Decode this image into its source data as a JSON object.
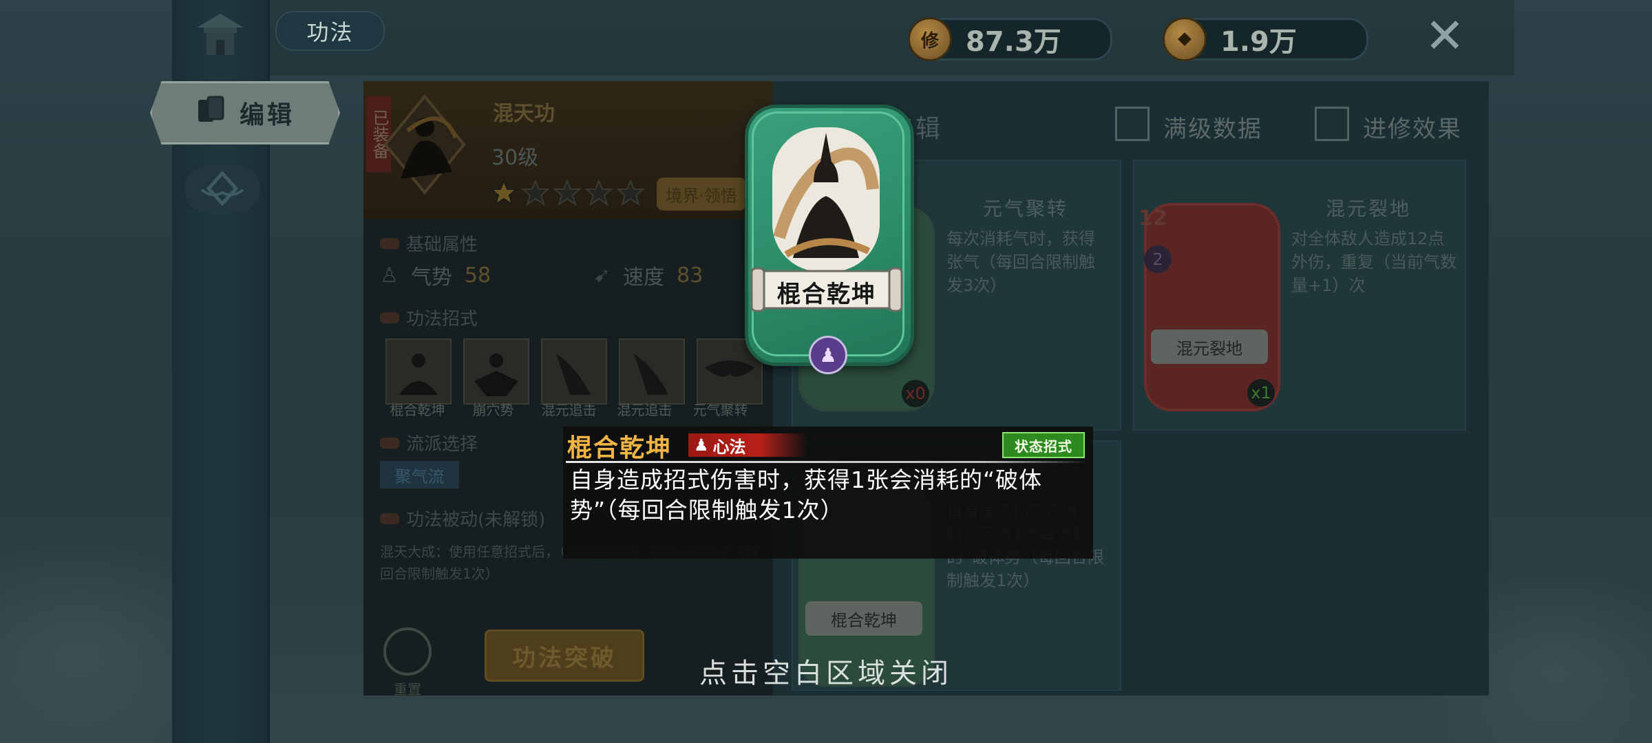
{
  "header": {
    "module_tab": "功法",
    "side_edit_tab": "编辑"
  },
  "currencies": [
    {
      "icon": "cultivation-coin-icon",
      "glyph": "修",
      "amount": "87.3万"
    },
    {
      "icon": "copper-coin-icon",
      "glyph": "",
      "amount": "1.9万"
    }
  ],
  "art": {
    "equipped_badge": "已装备",
    "name": "混天功",
    "level": "30级",
    "stars_filled": 1,
    "stars_total": 5,
    "realm_button": "境界·领悟",
    "sections": {
      "base": "基础属性",
      "moves": "功法招式",
      "school": "流派选择",
      "passive": "功法被动(未解锁)"
    },
    "stats": [
      {
        "label": "气势",
        "value": "58"
      },
      {
        "label": "速度",
        "value": "83"
      }
    ],
    "moves": [
      "棍合乾坤",
      "崩穴势",
      "混元追击",
      "混元追击",
      "元气聚转"
    ],
    "school_tag": "聚气流",
    "passive_text": "混天大成：使用任意招式后，（未完全可见）抽取一张招式（每回合限制触发1次）",
    "reset_label": "重置",
    "breakthrough_label": "功法突破"
  },
  "right_panel": {
    "edit_label": "编辑",
    "checkboxes": [
      {
        "label": "满级数据",
        "checked": false
      },
      {
        "label": "进修效果",
        "checked": false
      }
    ],
    "cards": [
      {
        "name": "元气聚转",
        "desc": "每次消耗气时，获得张气（每回合限制触发3次）",
        "count": "x0"
      },
      {
        "name": "混元裂地",
        "scroll": "混元裂地",
        "desc": "对全体敌人造成12点外伤，重复（当前气数量+1）次",
        "count": "x1",
        "cost": "12",
        "energy": "2"
      },
      {
        "name": "棍合乾坤",
        "scroll": "棍合乾坤",
        "desc": "自身造成招式伤害时，获得1张会消耗的“破体势”（每回合限制触发1次）"
      }
    ]
  },
  "popup": {
    "card_name": "棍合乾坤",
    "tooltip_title": "棍合乾坤",
    "type_tag": "心法",
    "state_tag": "状态招式",
    "description": "自身造成招式伤害时，获得1张会消耗的“破体势”（每回合限制触发1次）"
  },
  "close_hint": "点击空白区域关闭",
  "colors": {
    "card_green": "#2a8a66",
    "title_gold": "#f1b546",
    "type_red": "#b72019",
    "state_green": "#2d8a1f"
  }
}
